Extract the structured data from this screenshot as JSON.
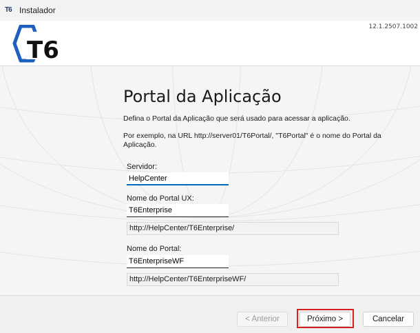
{
  "window": {
    "icon_text": "T6",
    "title": "Instalador"
  },
  "header": {
    "version": "12.1.2507.1002",
    "logo_text": "T6",
    "logo_color": "#1f5fbf"
  },
  "main": {
    "title": "Portal da Aplicação",
    "description": "Defina o Portal da Aplicação que será usado para acessar a aplicação.",
    "example": "Por exemplo, na URL http://server01/T6Portal/, \"T6Portal\" é o nome do Portal da Aplicação.",
    "server": {
      "label": "Servidor:",
      "value": "HelpCenter"
    },
    "portal_ux": {
      "label": "Nome do Portal UX:",
      "value": "T6Enterprise",
      "url": "http://HelpCenter/T6Enterprise/"
    },
    "portal": {
      "label": "Nome do Portal:",
      "value": "T6EnterpriseWF",
      "url": "http://HelpCenter/T6EnterpriseWF/"
    }
  },
  "footer": {
    "back_label": "< Anterior",
    "next_label": "Próximo >",
    "cancel_label": "Cancelar",
    "highlight_color": "#d42020"
  }
}
